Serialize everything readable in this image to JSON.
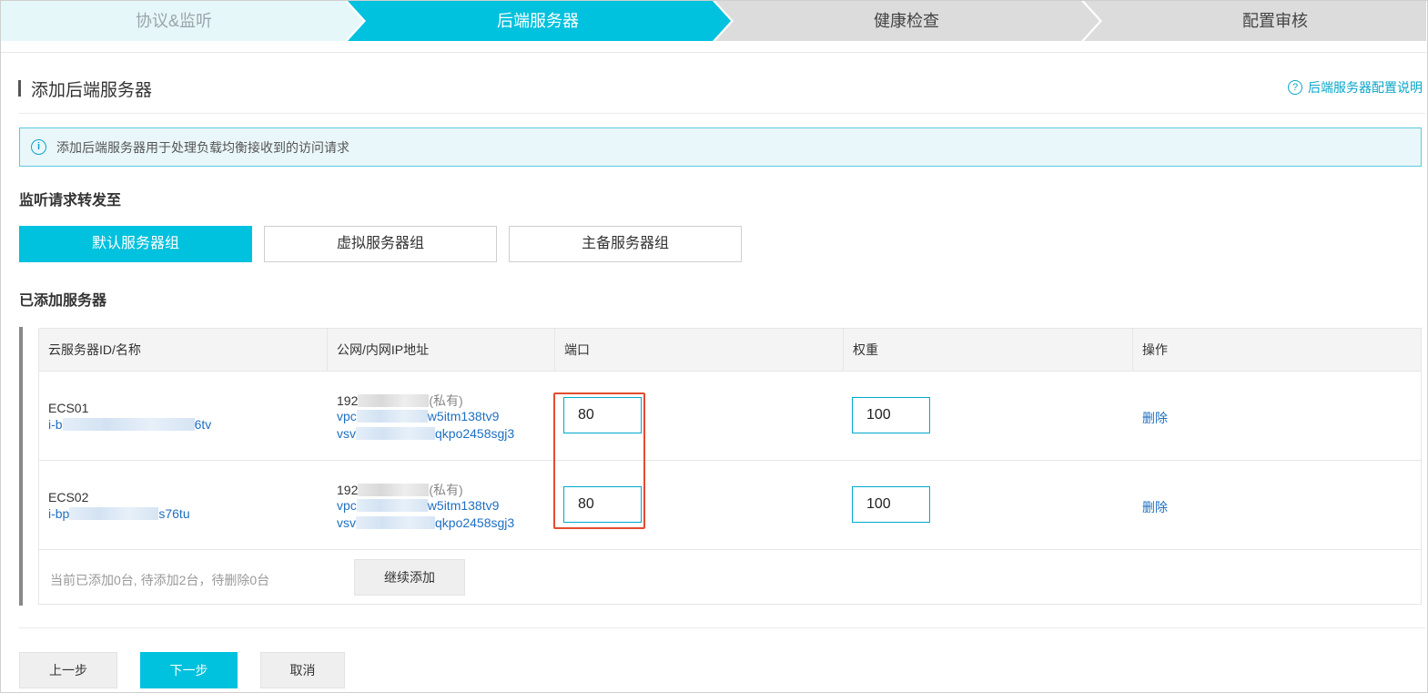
{
  "wizard": {
    "steps": [
      {
        "label": "协议&监听",
        "state": "done"
      },
      {
        "label": "后端服务器",
        "state": "active"
      },
      {
        "label": "健康检查",
        "state": "pending"
      },
      {
        "label": "配置审核",
        "state": "pending"
      }
    ],
    "colors": {
      "done": "#e6f7fa",
      "active": "#00c1de",
      "pending": "#dcdcdc"
    }
  },
  "section": {
    "title": "添加后端服务器",
    "help_link": "后端服务器配置说明",
    "help_icon": "question-circle-icon"
  },
  "info": {
    "icon": "info-circle-icon",
    "text": "添加后端服务器用于处理负载均衡接收到的访问请求"
  },
  "forward": {
    "label": "监听请求转发至",
    "groups": [
      "默认服务器组",
      "虚拟服务器组",
      "主备服务器组"
    ],
    "selected": "默认服务器组"
  },
  "servers": {
    "label": "已添加服务器",
    "columns": [
      "云服务器ID/名称",
      "公网/内网IP地址",
      "端口",
      "权重",
      "操作"
    ],
    "rows": [
      {
        "name": "ECS01",
        "id_prefix": "i-b",
        "id_suffix": "6tv",
        "ip_prefix": "192",
        "ip_type": "(私有)",
        "vpc_prefix": "vpc",
        "vpc_suffix": "w5itm138tv9",
        "vsw_prefix": "vsv",
        "vsw_suffix": "qkpo2458sgj3",
        "port": "80",
        "weight": "100",
        "action": "删除"
      },
      {
        "name": "ECS02",
        "id_prefix": "i-bp",
        "id_suffix": "s76tu",
        "ip_prefix": "192",
        "ip_type": "(私有)",
        "vpc_prefix": "vpc",
        "vpc_suffix": "w5itm138tv9",
        "vsw_prefix": "vsv",
        "vsw_suffix": "qkpo2458sgj3",
        "port": "80",
        "weight": "100",
        "action": "删除"
      }
    ],
    "summary": "当前已添加0台, 待添加2台，待删除0台",
    "continue_label": "继续添加"
  },
  "nav": {
    "prev": "上一步",
    "next": "下一步",
    "cancel": "取消"
  },
  "accent_color": "#00c1de",
  "highlight_color": "#e34c2f"
}
